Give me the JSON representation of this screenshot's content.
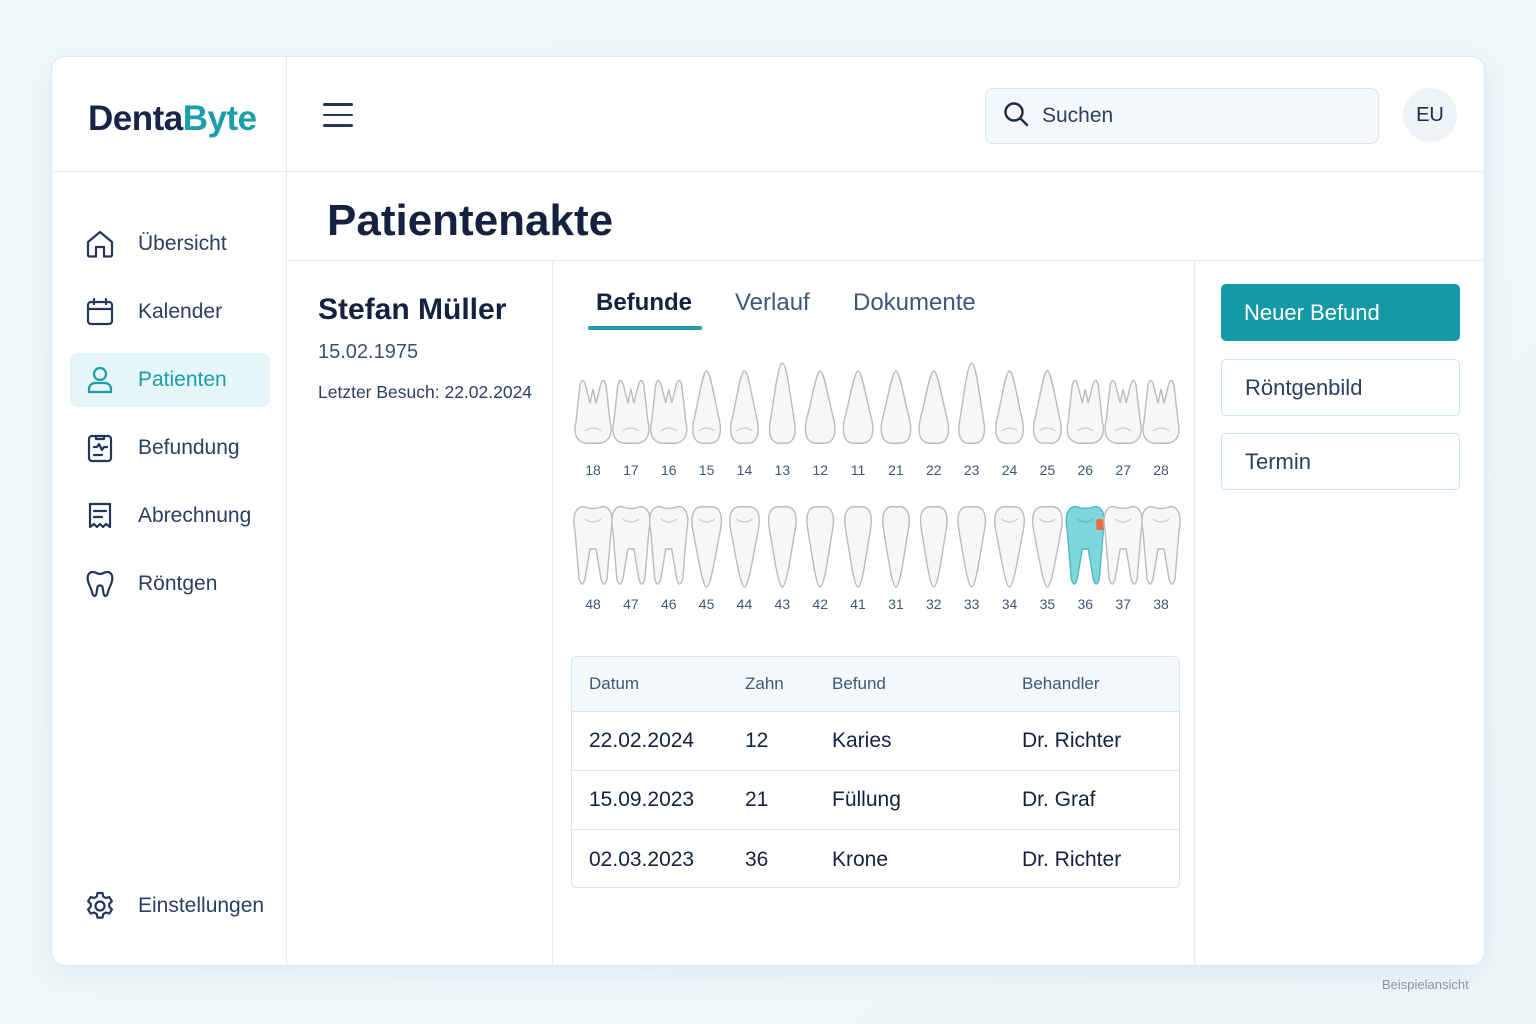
{
  "app": {
    "logo_part1": "Denta",
    "logo_part2": "Byte",
    "brand_color": "#1a9eac",
    "dark_color": "#17254a"
  },
  "sidebar": {
    "items": [
      {
        "label": "Übersicht",
        "icon": "home-icon",
        "active": false
      },
      {
        "label": "Kalender",
        "icon": "calendar-icon",
        "active": false
      },
      {
        "label": "Patienten",
        "icon": "user-icon",
        "active": true
      },
      {
        "label": "Befundung",
        "icon": "chart-document-icon",
        "active": false
      },
      {
        "label": "Abrechnung",
        "icon": "receipt-icon",
        "active": false
      },
      {
        "label": "Röntgen",
        "icon": "tooth-icon",
        "active": false
      }
    ],
    "settings": {
      "label": "Einstellungen",
      "icon": "gear-icon"
    }
  },
  "topbar": {
    "search_placeholder": "Suchen",
    "avatar_initials": "EU"
  },
  "page": {
    "title": "Patientenakte"
  },
  "patient": {
    "name": "Stefan Müller",
    "dob": "15.02.1975",
    "last_visit": "Letzter Besuch: 22.02.2024"
  },
  "tabs": [
    {
      "label": "Befunde",
      "active": true
    },
    {
      "label": "Verlauf",
      "active": false
    },
    {
      "label": "Dokumente",
      "active": false
    }
  ],
  "dental_chart": {
    "upper": [
      "18",
      "17",
      "16",
      "15",
      "14",
      "13",
      "12",
      "11",
      "21",
      "22",
      "23",
      "24",
      "25",
      "26",
      "27",
      "28"
    ],
    "lower": [
      "48",
      "47",
      "46",
      "45",
      "44",
      "43",
      "42",
      "41",
      "31",
      "32",
      "33",
      "34",
      "35",
      "36",
      "37",
      "38"
    ],
    "highlighted_tooth": "36",
    "highlight_color": "#7fd6dc",
    "marker_color": "#f06e3c"
  },
  "findings_table": {
    "headers": [
      "Datum",
      "Zahn",
      "Befund",
      "Behandler"
    ],
    "rows": [
      [
        "22.02.2024",
        "12",
        "Karies",
        "Dr. Richter"
      ],
      [
        "15.09.2023",
        "21",
        "Füllung",
        "Dr. Graf"
      ],
      [
        "02.03.2023",
        "36",
        "Krone",
        "Dr. Richter"
      ]
    ]
  },
  "actions": {
    "primary": "Neuer Befund",
    "xray": "Röntgenbild",
    "appointment": "Termin"
  },
  "footer": {
    "note": "Beispielansicht"
  }
}
